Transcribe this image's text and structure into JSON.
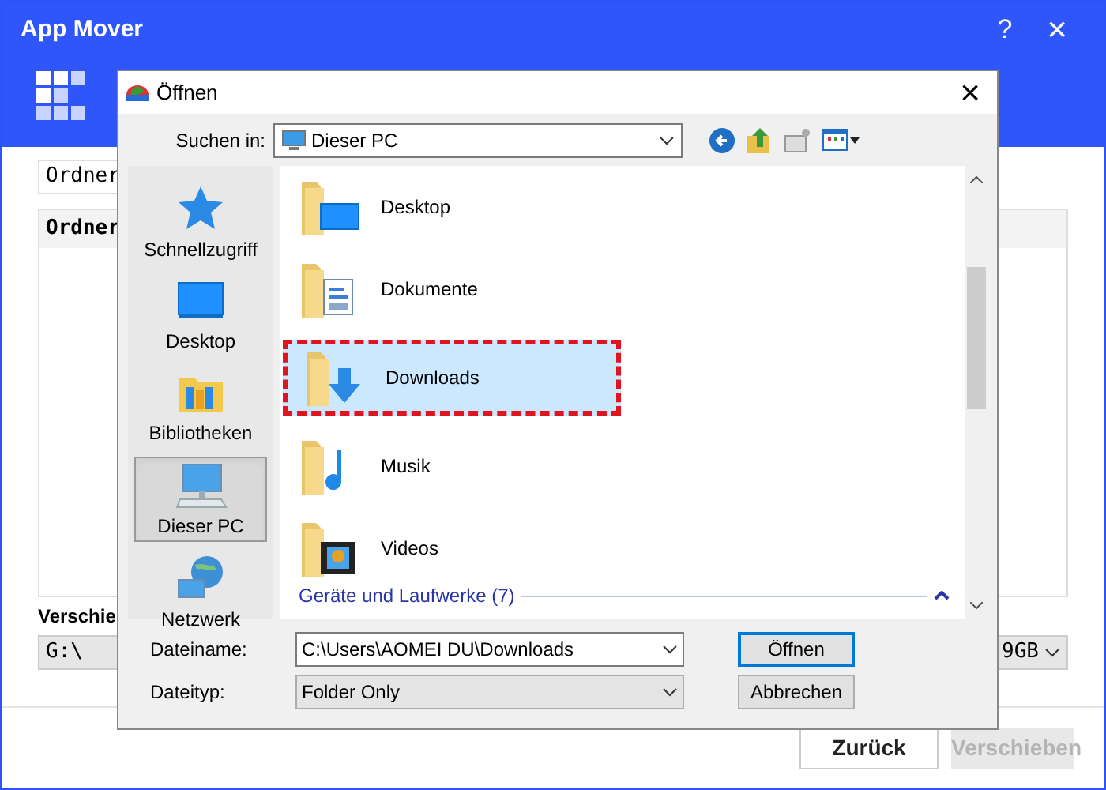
{
  "window": {
    "title": "App Mover",
    "help": "?",
    "close": "×"
  },
  "background": {
    "folder_field": "Ordner",
    "table_header": "Ordner",
    "move_label": "Verschie",
    "target_field": "G:\\",
    "size_field": "9GB"
  },
  "buttons": [
    {
      "label": "Zurück",
      "disabled": false
    },
    {
      "label": "Verschieben",
      "disabled": true
    }
  ],
  "dialog": {
    "title": "Öffnen",
    "close": "×",
    "look_in_label": "Suchen in:",
    "look_in": "Dieser PC",
    "places": [
      {
        "label": "Schnellzugriff",
        "kind": "star",
        "selected": false
      },
      {
        "label": "Desktop",
        "kind": "desktop",
        "selected": false
      },
      {
        "label": "Bibliotheken",
        "kind": "library",
        "selected": false
      },
      {
        "label": "Dieser PC",
        "kind": "pc",
        "selected": true
      },
      {
        "label": "Netzwerk",
        "kind": "network",
        "selected": false
      }
    ],
    "items": [
      {
        "label": "Desktop",
        "kind": "desktop",
        "selected": false
      },
      {
        "label": "Dokumente",
        "kind": "document",
        "selected": false
      },
      {
        "label": "Downloads",
        "kind": "download",
        "selected": true
      },
      {
        "label": "Musik",
        "kind": "music",
        "selected": false
      },
      {
        "label": "Videos",
        "kind": "video",
        "selected": false
      }
    ],
    "group": {
      "label": "Geräte und Laufwerke (7)",
      "expanded": true
    },
    "file_name_label": "Dateiname:",
    "file_name": "C:\\Users\\AOMEI DU\\Downloads",
    "file_type_label": "Dateityp:",
    "file_type": "Folder Only",
    "buttons": [
      {
        "label": "Öffnen",
        "default": true
      },
      {
        "label": "Abbrechen",
        "default": false
      }
    ]
  }
}
